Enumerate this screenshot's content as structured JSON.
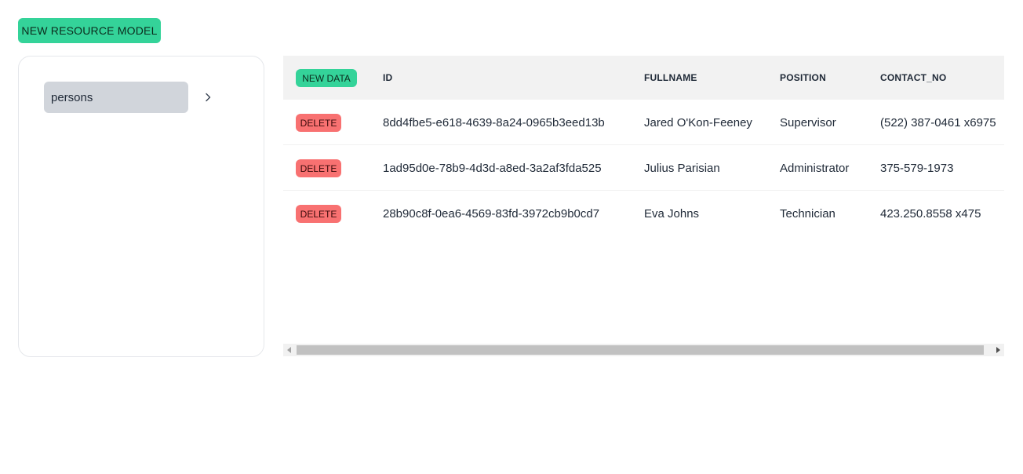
{
  "toolbar": {
    "new_resource_label": "NEW RESOURCE MODEL"
  },
  "sidebar": {
    "items": [
      {
        "label": "persons"
      }
    ]
  },
  "table": {
    "new_data_label": "NEW DATA",
    "delete_label": "DELETE",
    "columns": [
      "ID",
      "FULLNAME",
      "POSITION",
      "CONTACT_NO"
    ],
    "rows": [
      {
        "id": "8dd4fbe5-e618-4639-8a24-0965b3eed13b",
        "fullname": "Jared O'Kon-Feeney",
        "position": "Supervisor",
        "contact_no": "(522) 387-0461 x6975"
      },
      {
        "id": "1ad95d0e-78b9-4d3d-a8ed-3a2af3fda525",
        "fullname": "Julius Parisian",
        "position": "Administrator",
        "contact_no": "375-579-1973"
      },
      {
        "id": "28b90c8f-0ea6-4569-83fd-3972cb9b0cd7",
        "fullname": "Eva Johns",
        "position": "Technician",
        "contact_no": "423.250.8558 x475"
      }
    ]
  },
  "icons": {
    "chevron": "chevron-right-icon",
    "scroll_left": "triangle-left-icon",
    "scroll_right": "triangle-right-icon"
  },
  "colors": {
    "accent_green": "#34d399",
    "delete_red": "#f87171",
    "selected_item": "#d1d5db",
    "header_bg": "#f2f2f2"
  }
}
